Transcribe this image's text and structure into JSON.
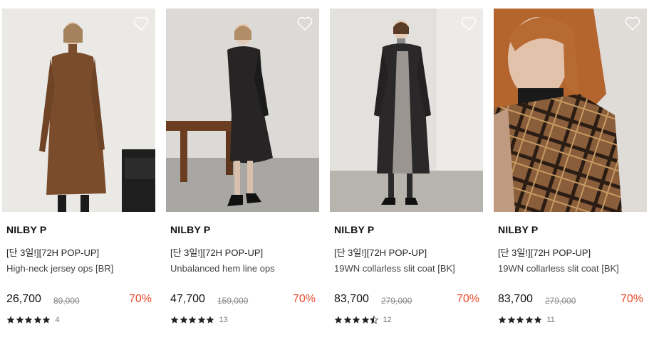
{
  "products": [
    {
      "brand": "NILBY P",
      "promo": "[단 3일!][72H POP-UP]",
      "name": "High-neck jersey ops [BR]",
      "price": "26,700",
      "original_price": "89,000",
      "discount": "70%",
      "rating": 5,
      "review_count": "4",
      "image": "brown-high-neck-dress-photo"
    },
    {
      "brand": "NILBY P",
      "promo": "[단 3일!][72H POP-UP]",
      "name": "Unbalanced hem line ops",
      "price": "47,700",
      "original_price": "159,000",
      "discount": "70%",
      "rating": 5,
      "review_count": "13",
      "image": "black-dress-photo"
    },
    {
      "brand": "NILBY P",
      "promo": "[단 3일!][72H POP-UP]",
      "name": "19WN collarless slit coat [BK]",
      "price": "83,700",
      "original_price": "279,000",
      "discount": "70%",
      "rating": 4.5,
      "review_count": "12",
      "image": "black-coat-photo"
    },
    {
      "brand": "NILBY P",
      "promo": "[단 3일!][72H POP-UP]",
      "name": "19WN collarless slit coat [BK]",
      "price": "83,700",
      "original_price": "279,000",
      "discount": "70%",
      "rating": 5,
      "review_count": "11",
      "image": "check-coat-closeup-photo"
    }
  ],
  "colors": {
    "discount": "#e74a2b",
    "star": "#222222"
  },
  "icons": {
    "wishlist": "heart-outline-icon",
    "rating": "star-icon"
  }
}
